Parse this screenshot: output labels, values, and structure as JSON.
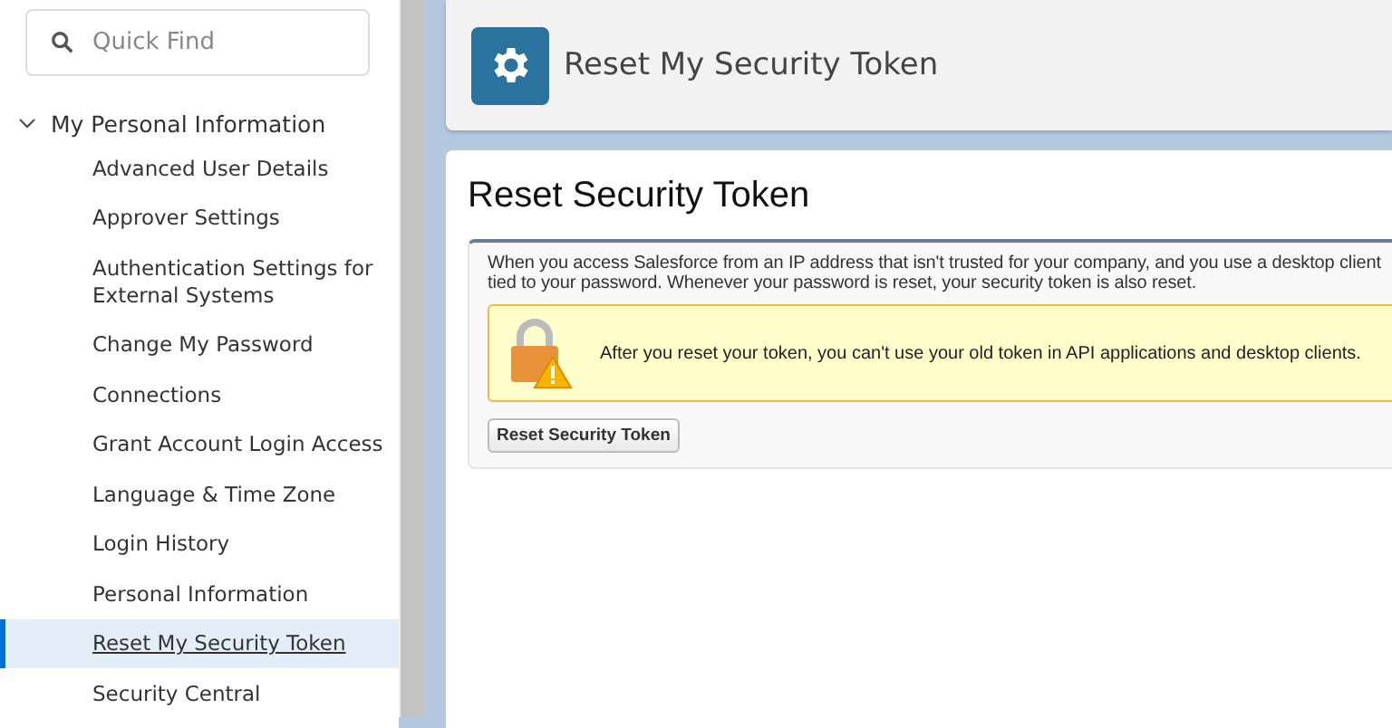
{
  "sidebar": {
    "search": {
      "placeholder": "Quick Find"
    },
    "tree": [
      {
        "label": "My Personal Information",
        "expanded": true,
        "children": [
          {
            "label": "Advanced User Details",
            "selected": false
          },
          {
            "label": "Approver Settings",
            "selected": false
          },
          {
            "label": "Authentication Settings for External Systems",
            "selected": false
          },
          {
            "label": "Change My Password",
            "selected": false
          },
          {
            "label": "Connections",
            "selected": false
          },
          {
            "label": "Grant Account Login Access",
            "selected": false
          },
          {
            "label": "Language & Time Zone",
            "selected": false
          },
          {
            "label": "Login History",
            "selected": false
          },
          {
            "label": "Personal Information",
            "selected": false
          },
          {
            "label": "Reset My Security Token",
            "selected": true
          },
          {
            "label": "Security Central",
            "selected": false
          }
        ]
      }
    ]
  },
  "header": {
    "title": "Reset My Security Token"
  },
  "content": {
    "heading": "Reset Security Token",
    "description": [
      "When you access Salesforce from an IP address that isn't trusted for your company, and you use a desktop client",
      "tied to your password. Whenever your password is reset, your security token is also reset."
    ],
    "warning": "After you reset your token, you can't use your old token in API applications and desktop clients.",
    "button": "Reset Security Token"
  }
}
